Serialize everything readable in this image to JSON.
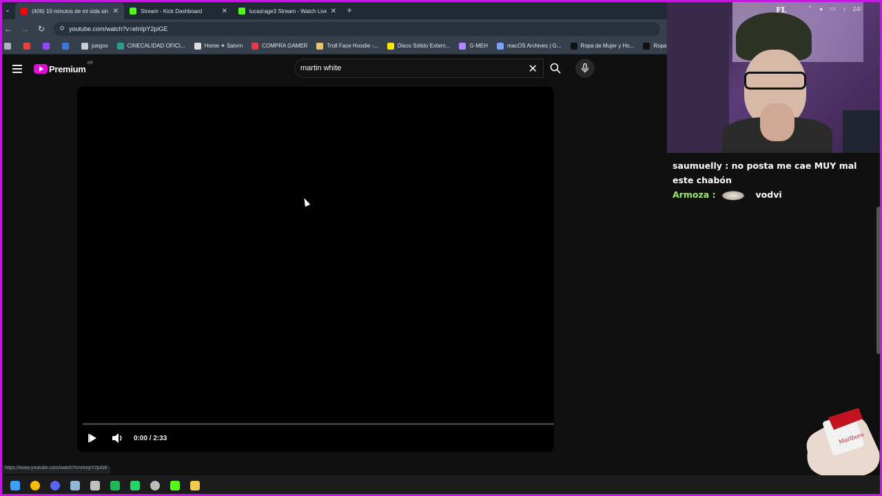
{
  "browser": {
    "tabs": [
      {
        "title": "(406) 10 minutos de mi vida sin",
        "favicon_color": "#ff0000",
        "active": true
      },
      {
        "title": "Stream - Kick Dashboard",
        "favicon_color": "#53fc18",
        "active": false
      },
      {
        "title": "lucazrage3 Stream - Watch Live",
        "favicon_color": "#53fc18",
        "active": false
      }
    ],
    "new_tab": "+",
    "url": "youtube.com/watch?v=eInIpY2piGE",
    "bookmarks": [
      {
        "label": "",
        "icon": "apps-icon",
        "color": "#aab4be"
      },
      {
        "label": "",
        "icon": "gmail-icon",
        "color": "#ea4335"
      },
      {
        "label": "",
        "icon": "twitch-icon",
        "color": "#9146ff"
      },
      {
        "label": "",
        "icon": "bookmark-blue-icon",
        "color": "#3c78d8"
      },
      {
        "label": "juegos",
        "icon": "folder-icon",
        "color": "#c8ccd0"
      },
      {
        "label": "CINECALIDAD OFICI...",
        "icon": "cinecalidad-icon",
        "color": "#2a9d8f"
      },
      {
        "label": "Home ✦ Satvrn",
        "icon": "star-icon",
        "color": "#dddddd"
      },
      {
        "label": "COMPRA GAMER",
        "icon": "compragamer-icon",
        "color": "#e63946"
      },
      {
        "label": "Troll Face Hoodie -...",
        "icon": "troll-icon",
        "color": "#e9c46a"
      },
      {
        "label": "Disco Sólido Extern...",
        "icon": "mercadolibre-icon",
        "color": "#ffe600"
      },
      {
        "label": "G-MEH",
        "icon": "gmeh-icon",
        "color": "#b388ff"
      },
      {
        "label": "macOS Archives | G...",
        "icon": "macos-icon",
        "color": "#7aa2f7"
      },
      {
        "label": "Ropa de Mujer y Ho...",
        "icon": "shein-icon",
        "color": "#111111"
      },
      {
        "label": "Ropa de Mujer y H",
        "icon": "shein-icon",
        "color": "#111111"
      }
    ]
  },
  "youtube": {
    "logo_text": "Premium",
    "country": "AR",
    "search_value": "martin white",
    "brand_color": "#e00ad9"
  },
  "player": {
    "time": "0:00 / 2:33",
    "progress": 0
  },
  "status_url": "https://www.youtube.com/watch?v=eInIpY2piGE",
  "chat": [
    {
      "user": "saumuelly",
      "text": " : no posta me cae MUY mal este chabón",
      "user_color": "#ffffff"
    },
    {
      "user": "Armoza",
      "text": "vodvi",
      "user_color": "#9ee86a"
    }
  ],
  "chat_separator": " :",
  "webcam_sign": "FL",
  "taskbar": {
    "apps": [
      {
        "name": "windows-start-icon",
        "color": "#3aa0ff"
      },
      {
        "name": "chrome-icon",
        "color": "#fbbc05"
      },
      {
        "name": "discord-icon",
        "color": "#5865f2"
      },
      {
        "name": "steam-icon",
        "color": "#8fb8d8"
      },
      {
        "name": "file-icon",
        "color": "#c0c0c0"
      },
      {
        "name": "spotify-icon",
        "color": "#1db954"
      },
      {
        "name": "whatsapp-icon",
        "color": "#25d366"
      },
      {
        "name": "obs-icon",
        "color": "#bbbbbb"
      },
      {
        "name": "kick-icon",
        "color": "#53fc18"
      },
      {
        "name": "file-explorer-icon",
        "color": "#f2c94c"
      }
    ],
    "clock": "24/"
  }
}
